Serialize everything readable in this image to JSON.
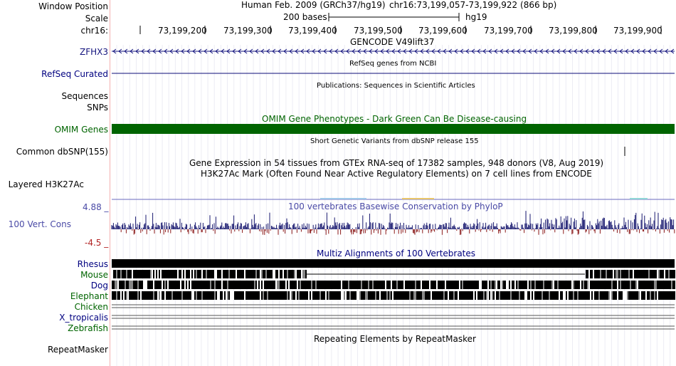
{
  "header": {
    "window_position_label": "Window Position",
    "assembly": "Human Feb. 2009 (GRCh37/hg19)",
    "position": "chr16:73,199,057-73,199,922 (866 bp)",
    "scale_label": "Scale",
    "scale_text": "200 bases",
    "scale_db": "hg19",
    "chrom_label": "chr16:",
    "ticks": [
      "73,199,200",
      "73,199,300",
      "73,199,400",
      "73,199,500",
      "73,199,600",
      "73,199,700",
      "73,199,800",
      "73,199,900"
    ]
  },
  "tracks": {
    "gencode": {
      "title": "GENCODE V49lift37",
      "label": "ZFHX3"
    },
    "refseq": {
      "title": "RefSeq genes from NCBI",
      "label": "RefSeq Curated"
    },
    "publications": {
      "title": "Publications: Sequences in Scientific Articles",
      "label_1": "Sequences",
      "label_2": "SNPs"
    },
    "omim": {
      "title": "OMIM Gene Phenotypes - Dark Green Can Be Disease-causing",
      "label": "OMIM Genes",
      "color": "#006400"
    },
    "dbsnp": {
      "title": "Short Genetic Variants from dbSNP release 155",
      "label": "Common dbSNP(155)"
    },
    "gtex": {
      "title": "Gene Expression in 54 tissues from GTEx RNA-seq of 17382 samples, 948 donors (V8, Aug 2019)"
    },
    "h3k27ac": {
      "title": "H3K27Ac Mark (Often Found Near Active Regulatory Elements) on 7 cell lines from ENCODE",
      "label": "Layered H3K27Ac"
    },
    "phylop": {
      "title": "100 vertebrates Basewise Conservation by PhyloP",
      "label": "100 Vert. Cons",
      "max_label": "4.88 _",
      "min_label": "-4.5 _",
      "pos_color": "#191970",
      "neg_color": "#8b1a1a"
    },
    "multiz": {
      "title": "Multiz Alignments of 100 Vertebrates",
      "species": [
        "Rhesus",
        "Mouse",
        "Dog",
        "Elephant",
        "Chicken",
        "X_tropicalis",
        "Zebrafish"
      ]
    },
    "repeatmasker": {
      "title": "Repeating Elements by RepeatMasker",
      "label": "RepeatMasker"
    }
  }
}
